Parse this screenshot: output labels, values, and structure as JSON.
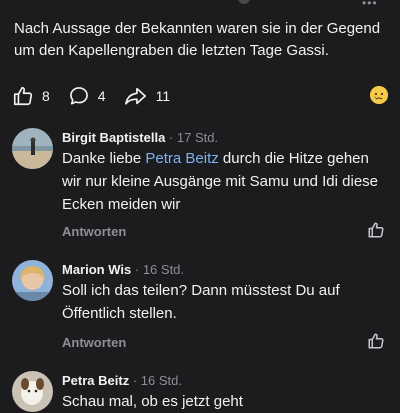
{
  "post": {
    "text": "Nach Aussage der Bekannten waren sie in der Gegend um den Kapellengraben die letzten Tage Gassi."
  },
  "actions": {
    "likes": "8",
    "comments": "4",
    "shares": "11"
  },
  "comments": [
    {
      "name": "Birgit Baptistella",
      "separator": "·",
      "time": "17 Std.",
      "body_before": "Danke liebe ",
      "mention": "Petra Beitz",
      "body_after": " durch die Hitze gehen wir nur kleine Ausgänge mit Samu und Idi diese Ecken meiden wir",
      "reply": "Antworten"
    },
    {
      "name": "Marion Wis",
      "separator": "·",
      "time": "16 Std.",
      "body": "Soll ich das teilen? Dann müsstest Du auf Öffentlich stellen.",
      "reply": "Antworten"
    },
    {
      "name": "Petra Beitz",
      "separator": "·",
      "time": "16 Std.",
      "body": "Schau mal, ob es jetzt geht"
    }
  ],
  "icons": {
    "like": "thumbs-up-icon",
    "comment": "speech-bubble-icon",
    "share": "share-arrow-icon",
    "reaction": "sad-emoji-icon",
    "more": "more-dots-icon"
  },
  "colors": {
    "background": "#1c1c1e",
    "text": "#f2f2f2",
    "secondary": "#8e8e93",
    "mention": "#7fb0f2"
  }
}
